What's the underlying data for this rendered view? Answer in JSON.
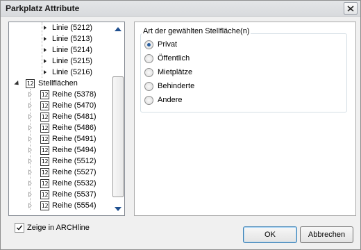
{
  "window": {
    "title": "Parkplatz Attribute"
  },
  "tree": {
    "children_top": [
      "Linie (5212)",
      "Linie (5213)",
      "Linie (5214)",
      "Linie (5215)",
      "Linie (5216)"
    ],
    "parent": {
      "label": "Stellflächen",
      "icon_text": "12"
    },
    "children": [
      {
        "label": "Reihe (5378)",
        "icon_text": "12"
      },
      {
        "label": "Reihe (5470)",
        "icon_text": "12"
      },
      {
        "label": "Reihe (5481)",
        "icon_text": "12"
      },
      {
        "label": "Reihe (5486)",
        "icon_text": "12"
      },
      {
        "label": "Reihe (5491)",
        "icon_text": "12"
      },
      {
        "label": "Reihe (5494)",
        "icon_text": "12"
      },
      {
        "label": "Reihe (5512)",
        "icon_text": "12"
      },
      {
        "label": "Reihe (5527)",
        "icon_text": "12"
      },
      {
        "label": "Reihe (5532)",
        "icon_text": "12"
      },
      {
        "label": "Reihe (5537)",
        "icon_text": "12"
      },
      {
        "label": "Reihe (5554)",
        "icon_text": "12"
      }
    ]
  },
  "group": {
    "legend": "Art der gewählten Stellfläche(n)",
    "options": [
      "Privat",
      "Öffentlich",
      "Mietplätze",
      "Behinderte",
      "Andere"
    ],
    "selected": "Privat"
  },
  "checkbox": {
    "label": "Zeige in ARCHline",
    "checked": true
  },
  "buttons": {
    "ok": "OK",
    "cancel": "Abbrechen"
  },
  "icons": {
    "close": "close-icon",
    "scroll_up": "arrow-up-icon",
    "scroll_down": "arrow-down-icon",
    "expand": "expand-triangle-icon",
    "collapse": "collapse-triangle-icon",
    "number": "numbered-box-icon",
    "check": "check-icon"
  },
  "colors": {
    "scroll_arrow": "#1f4f8f",
    "radio_dot": "#2a5fa0"
  }
}
